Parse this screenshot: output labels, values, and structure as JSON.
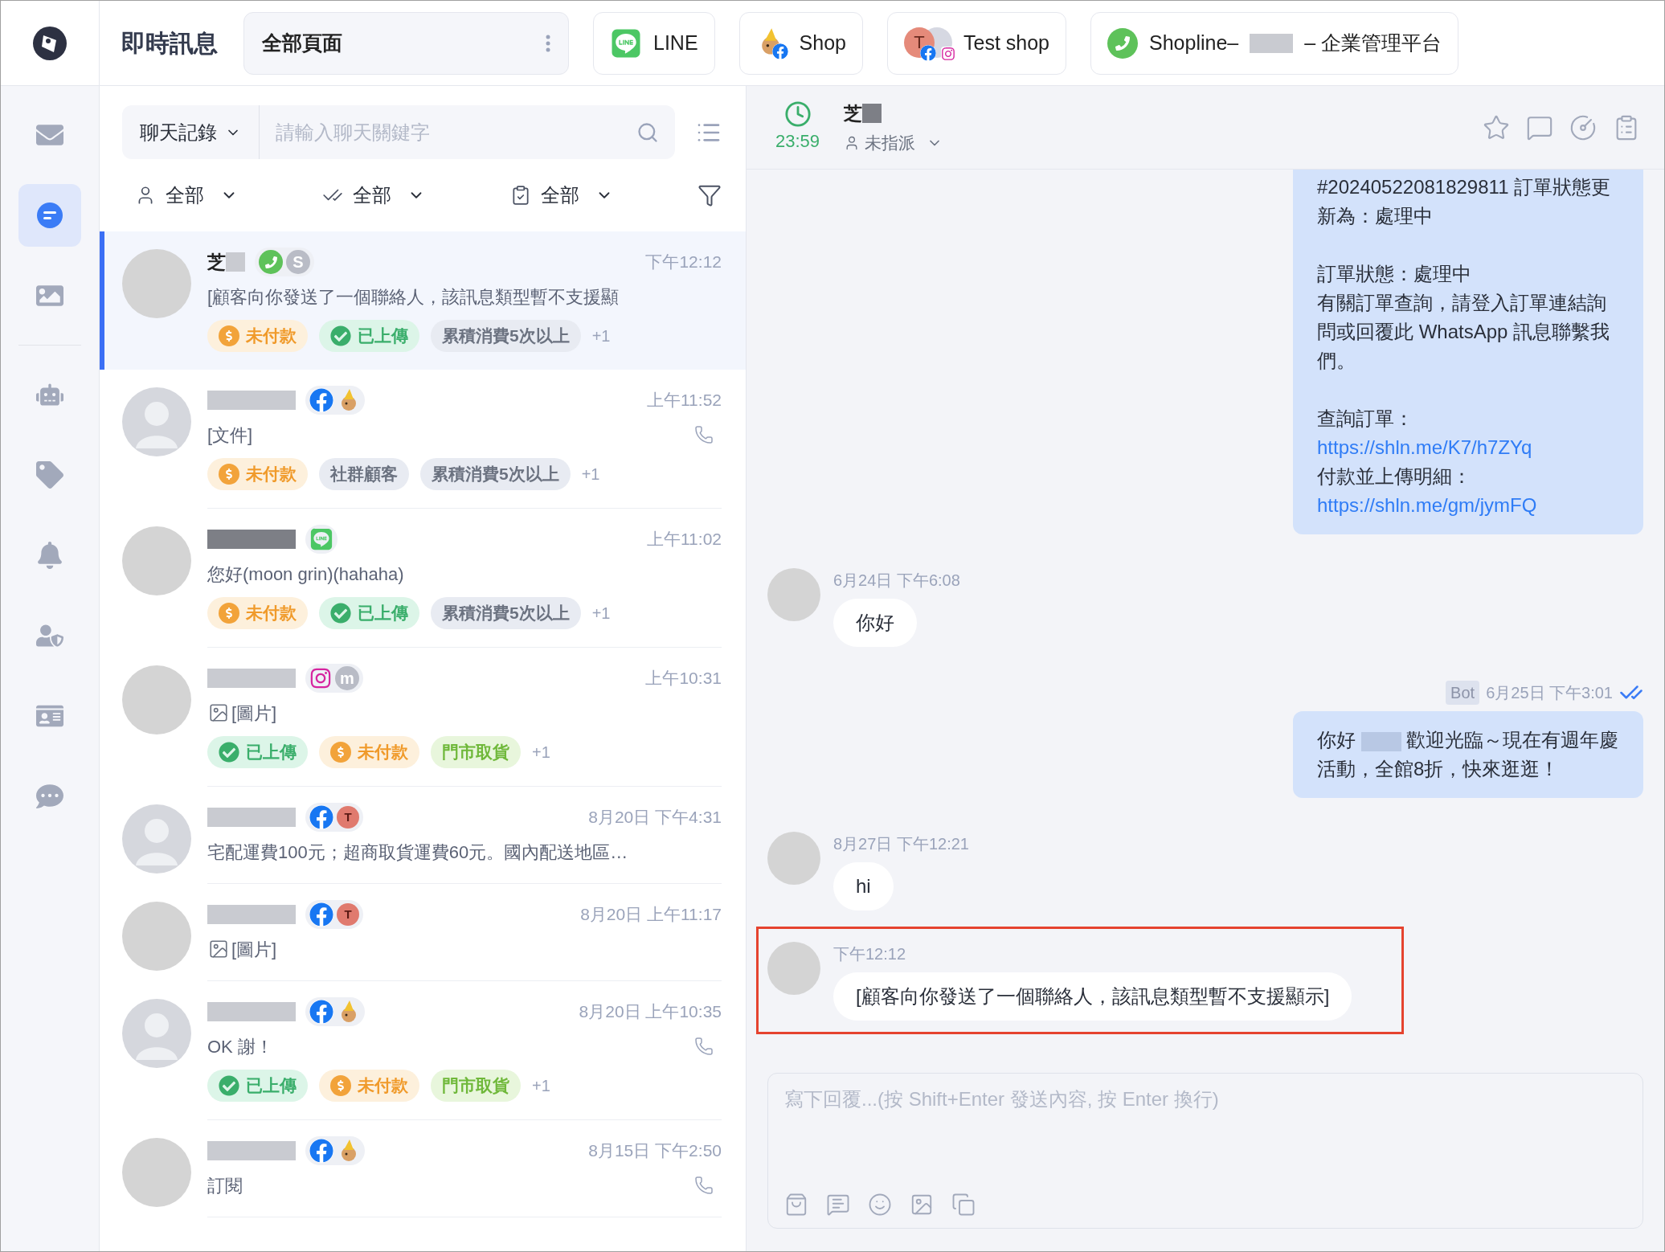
{
  "rail": {
    "groups": [
      [
        {
          "kind": "mail",
          "selected": false
        },
        {
          "kind": "chat",
          "selected": true
        },
        {
          "kind": "image",
          "selected": false
        }
      ],
      [
        {
          "kind": "bot",
          "selected": false
        },
        {
          "kind": "tag",
          "selected": false
        },
        {
          "kind": "bell",
          "selected": false
        },
        {
          "kind": "user-shield",
          "selected": false
        },
        {
          "kind": "card",
          "selected": false
        },
        {
          "kind": "more",
          "selected": false
        }
      ]
    ]
  },
  "header": {
    "title": "即時訊息",
    "tabs": [
      {
        "kind": "all",
        "label": "全部頁面",
        "selected": true
      },
      {
        "kind": "line",
        "label": "LINE",
        "selected": false
      },
      {
        "kind": "pet",
        "label": "Shop",
        "selected": false
      },
      {
        "kind": "stack",
        "letter": "T",
        "label": "Test shop",
        "selected": false
      },
      {
        "kind": "whatsapp",
        "label": "Shopline–",
        "redacted": true,
        "label_suffix": "– 企業管理平台",
        "selected": false
      }
    ]
  },
  "search": {
    "scope": "聊天記錄",
    "placeholder": "請輸入聊天關鍵字"
  },
  "filters": [
    {
      "kind": "user",
      "label": "全部"
    },
    {
      "kind": "read",
      "label": "全部"
    },
    {
      "kind": "task",
      "label": "全部"
    }
  ],
  "conversations": [
    {
      "avatar": {
        "kind": "plain"
      },
      "name": "芝",
      "channels": [
        {
          "kind": "whatsapp"
        },
        {
          "kind": "letter",
          "text": "S"
        }
      ],
      "time": "下午12:12",
      "preview": {
        "kind": "text",
        "text": "[顧客向你發送了一個聯絡人，該訊息類型暫不支援顯"
      },
      "phone": false,
      "selected": true,
      "tags": [
        {
          "kind": "unpaid",
          "label": "未付款"
        },
        {
          "kind": "uploaded",
          "label": "已上傳"
        },
        {
          "kind": "gray",
          "label": "累積消費5次以上"
        }
      ],
      "more": "+1"
    },
    {
      "avatar": {
        "kind": "silhouette"
      },
      "channels": [
        {
          "kind": "facebook"
        },
        {
          "kind": "pet"
        }
      ],
      "time": "上午11:52",
      "preview": {
        "kind": "text",
        "text": "[文件]"
      },
      "phone": true,
      "selected": false,
      "tags": [
        {
          "kind": "unpaid",
          "label": "未付款"
        },
        {
          "kind": "gray",
          "label": "社群顧客"
        },
        {
          "kind": "gray",
          "label": "累積消費5次以上"
        }
      ],
      "more": "+1"
    },
    {
      "avatar": {
        "kind": "plain"
      },
      "channels": [
        {
          "kind": "line"
        }
      ],
      "time": "上午11:02",
      "preview": {
        "kind": "text",
        "text": "您好(moon grin)(hahaha)"
      },
      "phone": false,
      "selected": false,
      "tags": [
        {
          "kind": "unpaid",
          "label": "未付款"
        },
        {
          "kind": "uploaded",
          "label": "已上傳"
        },
        {
          "kind": "gray",
          "label": "累積消費5次以上"
        }
      ],
      "more": "+1"
    },
    {
      "avatar": {
        "kind": "plain"
      },
      "channels": [
        {
          "kind": "instagram"
        },
        {
          "kind": "letter",
          "text": "m"
        }
      ],
      "time": "上午10:31",
      "preview": {
        "kind": "image",
        "text": "[圖片]"
      },
      "phone": false,
      "selected": false,
      "tags": [
        {
          "kind": "uploaded",
          "label": "已上傳"
        },
        {
          "kind": "unpaid",
          "label": "未付款"
        },
        {
          "kind": "green",
          "label": "門市取貨"
        }
      ],
      "more": "+1"
    },
    {
      "avatar": {
        "kind": "silhouette"
      },
      "channels": [
        {
          "kind": "facebook"
        },
        {
          "kind": "letter-red",
          "text": "T"
        }
      ],
      "time": "8月20日 下午4:31",
      "preview": {
        "kind": "text",
        "text": "宅配運費100元；超商取貨運費60元。國內配送地區…"
      },
      "phone": false,
      "selected": false
    },
    {
      "avatar": {
        "kind": "plain"
      },
      "channels": [
        {
          "kind": "facebook"
        },
        {
          "kind": "letter-red",
          "text": "T"
        }
      ],
      "time": "8月20日 上午11:17",
      "preview": {
        "kind": "image",
        "text": "[圖片]"
      },
      "phone": false,
      "selected": false
    },
    {
      "avatar": {
        "kind": "silhouette"
      },
      "channels": [
        {
          "kind": "facebook"
        },
        {
          "kind": "pet"
        }
      ],
      "time": "8月20日 上午10:35",
      "preview": {
        "kind": "text",
        "text": "OK 謝！"
      },
      "phone": true,
      "selected": false,
      "tags": [
        {
          "kind": "uploaded",
          "label": "已上傳"
        },
        {
          "kind": "unpaid",
          "label": "未付款"
        },
        {
          "kind": "green",
          "label": "門市取貨"
        }
      ],
      "more": "+1"
    },
    {
      "avatar": {
        "kind": "plain"
      },
      "channels": [
        {
          "kind": "facebook"
        },
        {
          "kind": "pet"
        }
      ],
      "time": "8月15日 下午2:50",
      "preview": {
        "kind": "text",
        "text": "訂閱"
      },
      "phone": true,
      "selected": false
    }
  ],
  "chat": {
    "timer": "23:59",
    "name": "芝",
    "assignee": "未指派",
    "messages": [
      {
        "kind": "outgoing",
        "cut_top": true,
        "paragraphs": [
          [
            {
              "text": "#20240522081829811 訂單狀態更新為：處理中",
              "link": false
            }
          ],
          [
            {
              "text": "訂單狀態：處理中",
              "link": false
            },
            {
              "text": "有關訂單查詢，請登入訂單連結詢問或回覆此 WhatsApp 訊息聯繫我們。",
              "link": false
            }
          ],
          [
            {
              "text": "查詢訂單：",
              "link": false
            },
            {
              "text": "https://shln.me/K7/h7ZYq",
              "link": true
            },
            {
              "text": "付款並上傳明細：",
              "link": false
            },
            {
              "text": "https://shln.me/gm/jymFQ",
              "link": true
            }
          ]
        ]
      },
      {
        "kind": "incoming",
        "time": "6月24日 下午6:08",
        "text": "你好",
        "highlighted": false
      },
      {
        "kind": "outgoing",
        "badge": "Bot",
        "time": "6月25日 下午3:01",
        "read": true,
        "before": "你好",
        "redacted": true,
        "after": "歡迎光臨～現在有週年慶活動，全館8折，快來逛逛！"
      },
      {
        "kind": "incoming",
        "time": "8月27日 下午12:21",
        "text": "hi",
        "highlighted": false
      },
      {
        "kind": "incoming",
        "time": "下午12:12",
        "text": "[顧客向你發送了一個聯絡人，該訊息類型暫不支援顯示]",
        "highlighted": true
      }
    ],
    "composer": {
      "placeholder": "寫下回覆...(按 Shift+Enter 發送內容, 按 Enter 換行)"
    }
  }
}
